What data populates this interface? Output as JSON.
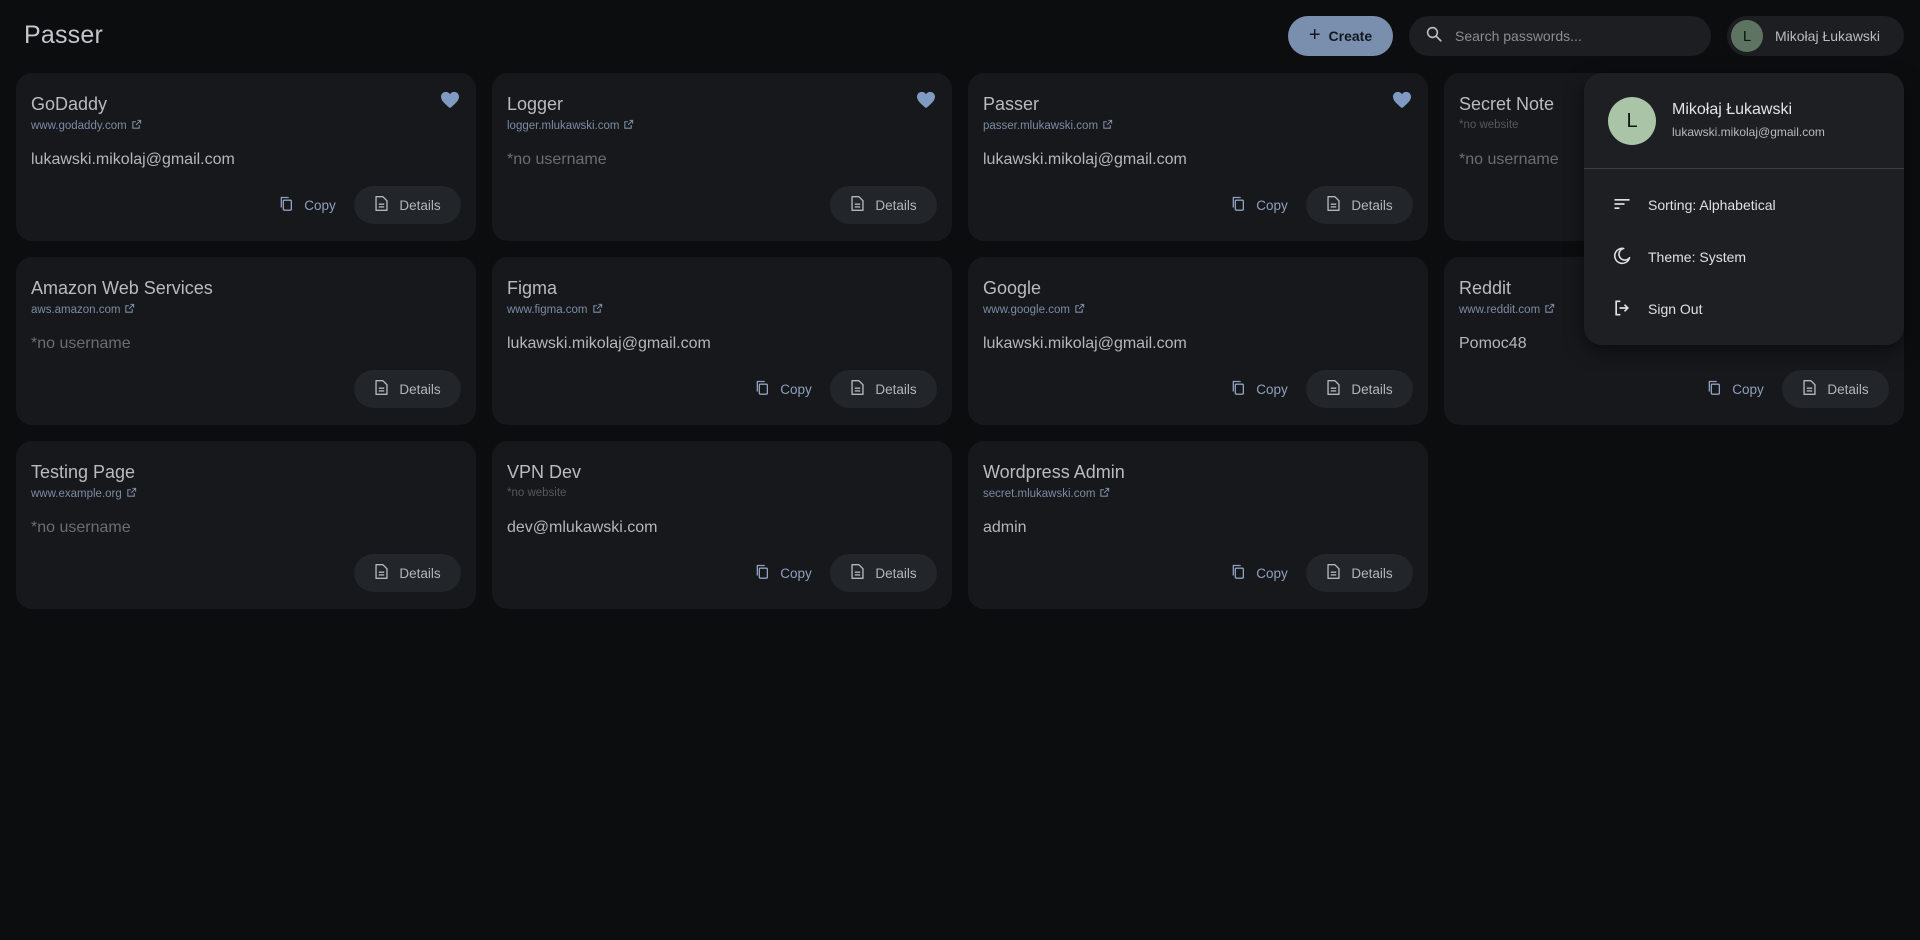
{
  "app": {
    "title": "Passer"
  },
  "toolbar": {
    "create_label": "Create"
  },
  "search": {
    "placeholder": "Search passwords..."
  },
  "user": {
    "initial": "L",
    "name": "Mikołaj Łukawski",
    "email": "lukawski.mikolaj@gmail.com"
  },
  "menu": {
    "sorting_label": "Sorting: Alphabetical",
    "theme_label": "Theme: System",
    "signout_label": "Sign Out"
  },
  "card_actions": {
    "copy_label": "Copy",
    "details_label": "Details"
  },
  "colors": {
    "accent": "#7a8fad",
    "background": "#0c0d0e",
    "card": "#17181b"
  },
  "cards": [
    {
      "title": "GoDaddy",
      "website": "www.godaddy.com",
      "username": "lukawski.mikolaj@gmail.com",
      "favorite": true
    },
    {
      "title": "Logger",
      "website": "logger.mlukawski.com",
      "username": "*no username",
      "favorite": true
    },
    {
      "title": "Passer",
      "website": "passer.mlukawski.com",
      "username": "lukawski.mikolaj@gmail.com",
      "favorite": true
    },
    {
      "title": "Secret Note",
      "website": "*no website",
      "username": "*no username",
      "favorite": false
    },
    {
      "title": "Amazon Web Services",
      "website": "aws.amazon.com",
      "username": "*no username",
      "favorite": false
    },
    {
      "title": "Figma",
      "website": "www.figma.com",
      "username": "lukawski.mikolaj@gmail.com",
      "favorite": false
    },
    {
      "title": "Google",
      "website": "www.google.com",
      "username": "lukawski.mikolaj@gmail.com",
      "favorite": false
    },
    {
      "title": "Reddit",
      "website": "www.reddit.com",
      "username": "Pomoc48",
      "favorite": false
    },
    {
      "title": "Testing Page",
      "website": "www.example.org",
      "username": "*no username",
      "favorite": false
    },
    {
      "title": "VPN Dev",
      "website": "*no website",
      "username": "dev@mlukawski.com",
      "favorite": false
    },
    {
      "title": "Wordpress Admin",
      "website": "secret.mlukawski.com",
      "username": "admin",
      "favorite": false
    }
  ]
}
